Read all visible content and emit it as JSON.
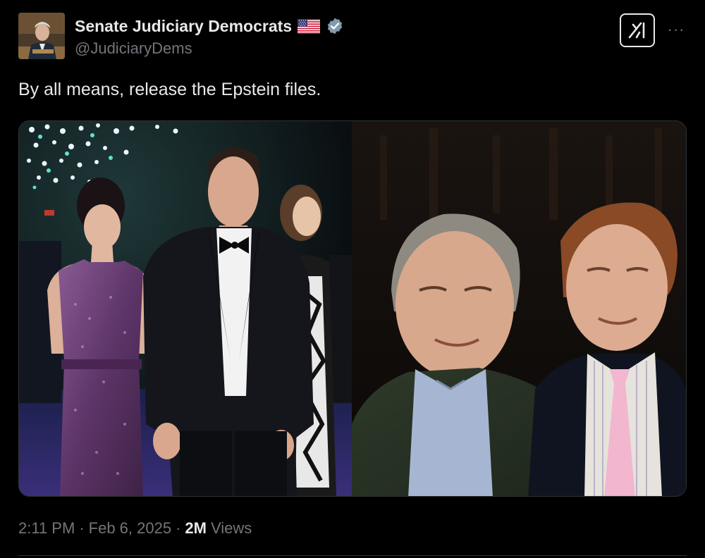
{
  "tweet": {
    "author": {
      "display_name": "Senate Judiciary Democrats",
      "handle": "@JudiciaryDems",
      "flag_icon": "us-flag-icon",
      "verified_icon": "verified-badge-icon"
    },
    "text": "By all means, release the Epstein files.",
    "media": {
      "left_photo": "photo-of-woman-and-man-in-tuxedo-at-event",
      "right_photo": "photo-of-two-men-smiling"
    },
    "time": "2:11 PM",
    "separator": "·",
    "date": "Feb 6, 2025",
    "views_count": "2M",
    "views_label": "Views"
  },
  "actions": {
    "grok_icon": "grok-icon",
    "more_icon": "more-icon",
    "more_label": "···"
  },
  "colors": {
    "background": "#000000",
    "text_primary": "#e7e9ea",
    "text_secondary": "#71767b",
    "verified": "#829aab"
  }
}
